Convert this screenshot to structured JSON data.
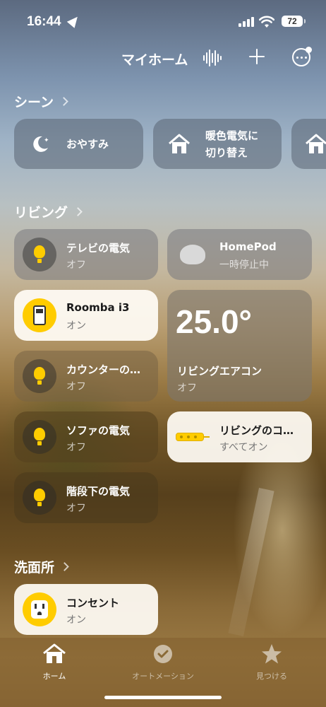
{
  "status_bar": {
    "time": "16:44",
    "battery": "72"
  },
  "header": {
    "title": "マイホーム"
  },
  "scenes": {
    "title": "シーン",
    "items": [
      {
        "label": "おやすみ",
        "icon": "moon-icon"
      },
      {
        "label": "暖色電気に\n切り替え",
        "icon": "house-icon"
      },
      {
        "label": "",
        "icon": "house-icon"
      }
    ]
  },
  "living": {
    "title": "リビング",
    "tv_light": {
      "name": "テレビの電気",
      "status": "オフ"
    },
    "homepod": {
      "name": "HomePod",
      "status": "一時停止中"
    },
    "roomba": {
      "name": "Roomba i3",
      "status": "オン"
    },
    "aircon": {
      "temp": "25.0°",
      "name": "リビングエアコン",
      "status": "オフ"
    },
    "counter_light": {
      "name": "カウンターの…",
      "status": "オフ"
    },
    "sofa_light": {
      "name": "ソファの電気",
      "status": "オフ"
    },
    "living_outlet": {
      "name": "リビングのコ…",
      "status": "すべてオン"
    },
    "stairs_light": {
      "name": "階段下の電気",
      "status": "オフ"
    }
  },
  "washroom": {
    "title": "洗面所",
    "outlet": {
      "name": "コンセント",
      "status": "オン"
    }
  },
  "tabs": [
    {
      "label": "ホーム",
      "icon": "house-icon",
      "active": true
    },
    {
      "label": "オートメーション",
      "icon": "clock-check-icon",
      "active": false
    },
    {
      "label": "見つける",
      "icon": "star-icon",
      "active": false
    }
  ],
  "colors": {
    "accent_yellow": "#ffcc00",
    "tile_on": "#fffcf5"
  }
}
